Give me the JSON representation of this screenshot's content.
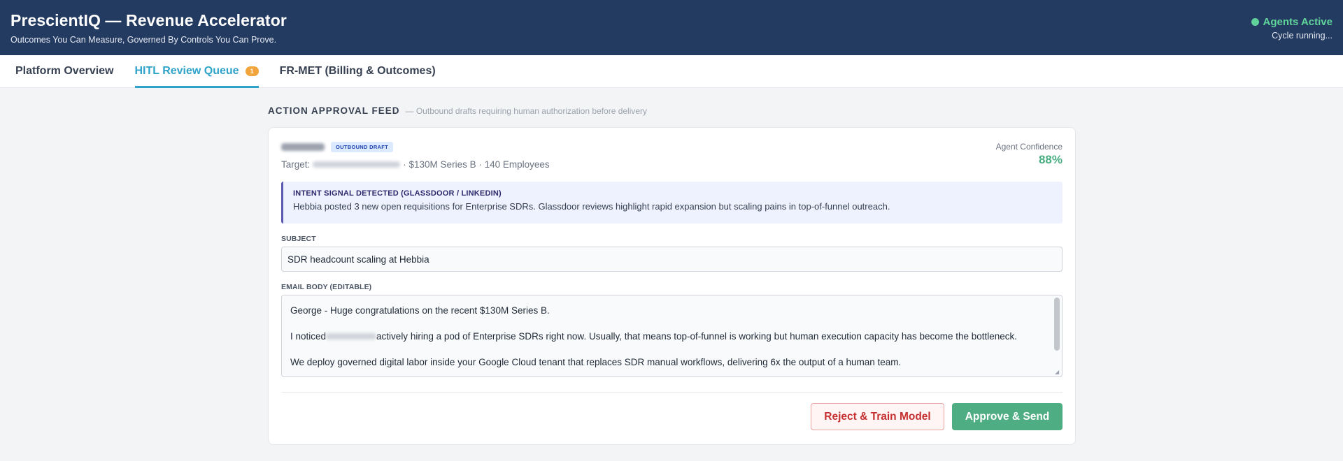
{
  "header": {
    "title": "PrescientIQ — Revenue Accelerator",
    "tagline": "Outcomes You Can Measure, Governed By Controls You Can Prove.",
    "status_label": "Agents Active",
    "status_sub": "Cycle running...",
    "status_color": "#5fd39a"
  },
  "tabs": [
    {
      "label": "Platform Overview"
    },
    {
      "label": "HITL Review Queue",
      "badge": "1",
      "active": true
    },
    {
      "label": "FR-MET (Billing & Outcomes)"
    }
  ],
  "feed": {
    "title": "ACTION APPROVAL FEED",
    "subtitle": "— Outbound drafts requiring human authorization before delivery"
  },
  "card": {
    "type_badge": "OUTBOUND DRAFT",
    "target_prefix": "Target:",
    "target_details": "· $130M Series B · 140 Employees",
    "confidence_label": "Agent Confidence",
    "confidence_value": "88%",
    "signal_title": "INTENT SIGNAL DETECTED (GLASSDOOR / LINKEDIN)",
    "signal_text": "Hebbia posted 3 new open requisitions for Enterprise SDRs. Glassdoor reviews highlight rapid expansion but scaling pains in top-of-funnel outreach.",
    "subject_label": "SUBJECT",
    "subject_value": "SDR headcount scaling at Hebbia",
    "body_label": "EMAIL BODY (EDITABLE)",
    "body_line1": "George - Huge congratulations on the recent $130M Series B.",
    "body_line2_prefix": "I noticed",
    "body_line2_rest": "actively hiring a pod of Enterprise SDRs right now. Usually, that means top-of-funnel is working but human execution capacity has become the bottleneck.",
    "body_line3": "We deploy governed digital labor inside your Google Cloud tenant that replaces SDR manual workflows, delivering 6x the output of a human team.",
    "reject_label": "Reject & Train Model",
    "approve_label": "Approve & Send"
  },
  "colors": {
    "header_bg": "#243b61",
    "accent": "#2fa3c9",
    "approve": "#4ead82",
    "reject": "#c53030",
    "badge": "#f0a43a"
  }
}
